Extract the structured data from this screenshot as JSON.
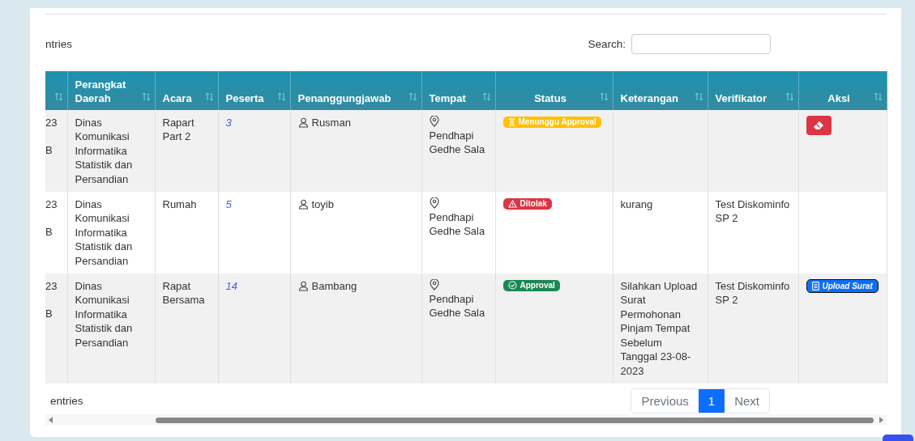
{
  "length_label": "ntries",
  "search": {
    "label": "Search:"
  },
  "table": {
    "columns": [
      "",
      "Perangkat Daerah",
      "Acara",
      "Peserta",
      "Penanggungjawab",
      "Tempat",
      "Status",
      "Keterangan",
      "Verifikator",
      "Aksi"
    ],
    "rows": [
      {
        "column_1": [
          "23",
          "B"
        ],
        "perangkat_daerah": "Dinas Komunikasi Informatika Statistik dan Persandian",
        "acara": "Rapart Part 2",
        "peserta": "3",
        "penanggungjawab": "Rusman",
        "tempat": "Pendhapi Gedhe Sala",
        "status": {
          "label": "Menunggu Approval",
          "kind": "pending"
        },
        "aksi": {
          "kind": "delete"
        }
      },
      {
        "column_1": [
          "23",
          "B"
        ],
        "perangkat_daerah": "Dinas Komunikasi Informatika Statistik dan Persandian",
        "acara": "Rumah",
        "peserta": "5",
        "penanggungjawab": "toyib",
        "tempat": "Pendhapi Gedhe Sala",
        "status": {
          "label": "Ditolak",
          "kind": "rejected"
        },
        "keterangan": "kurang",
        "verifikator": "Test Diskominfo SP 2",
        "aksi": {
          "kind": "none"
        }
      },
      {
        "column_1": [
          "23",
          "B"
        ],
        "perangkat_daerah": "Dinas Komunikasi Informatika Statistik dan Persandian",
        "acara": "Rapat Bersama",
        "peserta": "14",
        "penanggungjawab": "Bambang",
        "tempat": "Pendhapi Gedhe Sala",
        "status": {
          "label": "Approval",
          "kind": "approved"
        },
        "keterangan": "Silahkan Upload Surat Permohonan Pinjam Tempat Sebelum Tanggal 23-08-2023",
        "verifikator": "Test Diskominfo SP 2",
        "aksi": {
          "kind": "upload",
          "label": "Upload Surat"
        }
      }
    ]
  },
  "info_label": "entries",
  "pagination": [
    {
      "label": "Previous",
      "selected": false
    },
    {
      "label": "1",
      "selected": true
    },
    {
      "label": "Next",
      "selected": false
    }
  ]
}
